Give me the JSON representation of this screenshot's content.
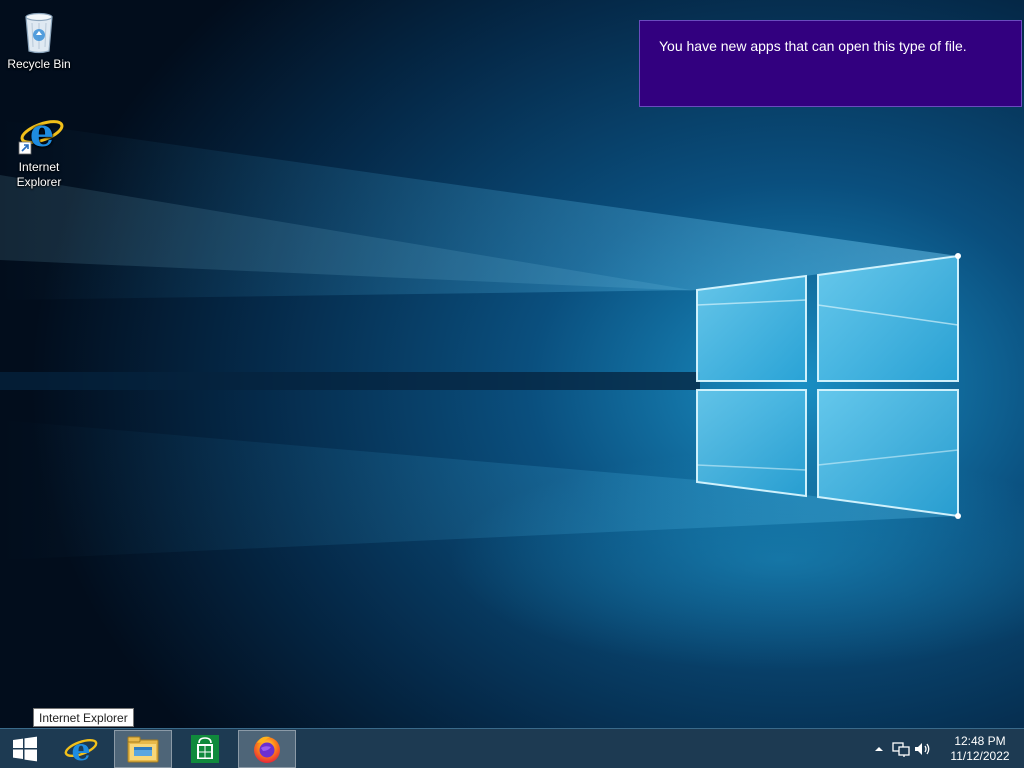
{
  "desktop": {
    "icons": [
      {
        "label": "Recycle Bin",
        "icon": "recycle-bin-icon"
      },
      {
        "label": "Internet\nExplorer",
        "icon": "internet-explorer-icon"
      }
    ]
  },
  "toast": {
    "message": "You have new apps that can open this type of file.",
    "background": "#32007f"
  },
  "tooltip": {
    "text": "Internet Explorer"
  },
  "taskbar": {
    "background": "#1d3a52",
    "start_icon": "windows-logo-icon",
    "pinned": [
      {
        "name": "Internet Explorer",
        "icon": "internet-explorer-icon"
      },
      {
        "name": "File Explorer",
        "icon": "file-explorer-icon",
        "active": true
      },
      {
        "name": "Store",
        "icon": "store-icon"
      },
      {
        "name": "Firefox",
        "icon": "firefox-icon",
        "active": true
      }
    ],
    "tray": {
      "icons": [
        "show-hidden-icons-icon",
        "network-icon",
        "volume-icon"
      ],
      "time": "12:48 PM",
      "date": "11/12/2022"
    }
  }
}
